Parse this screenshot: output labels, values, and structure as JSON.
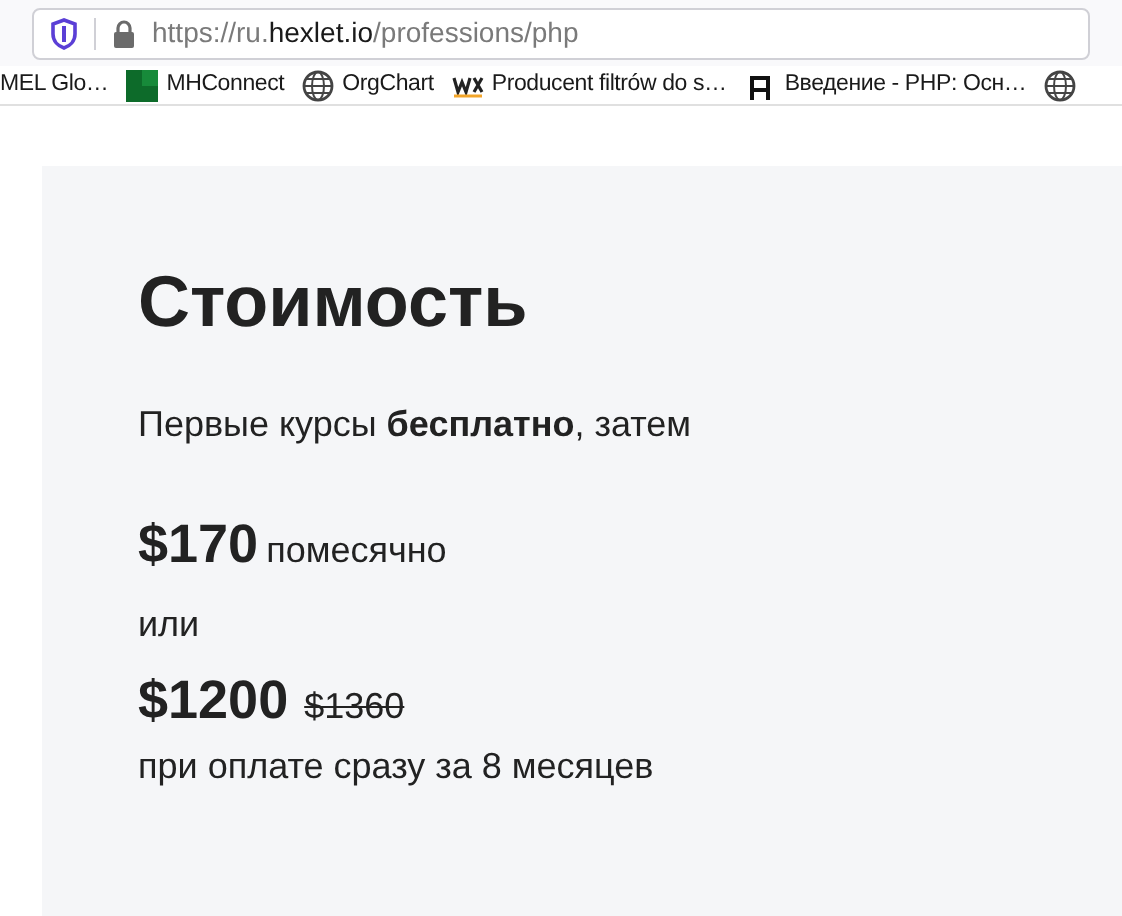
{
  "address_bar": {
    "url_parts": [
      "https://ru.",
      "hexlet.io",
      "/professions/php"
    ]
  },
  "bookmarks": [
    {
      "kind": "none",
      "label": "MEL Glo…"
    },
    {
      "kind": "tile",
      "label": "MHConnect"
    },
    {
      "kind": "globe",
      "label": "OrgChart"
    },
    {
      "kind": "wix",
      "label": "Producent filtrów do s…"
    },
    {
      "kind": "hexlet",
      "label": "Введение - PHP: Осн…"
    },
    {
      "kind": "globe"
    }
  ],
  "pricing": {
    "title": "Стоимость",
    "intro": "Первые курсы **бесплатно**, затем",
    "monthly_price": "$170",
    "monthly_note": "помесячно",
    "or": "или",
    "full_price": "$1200",
    "old_price": "$1360",
    "full_note": "при оплате сразу за 8 месяцев"
  }
}
